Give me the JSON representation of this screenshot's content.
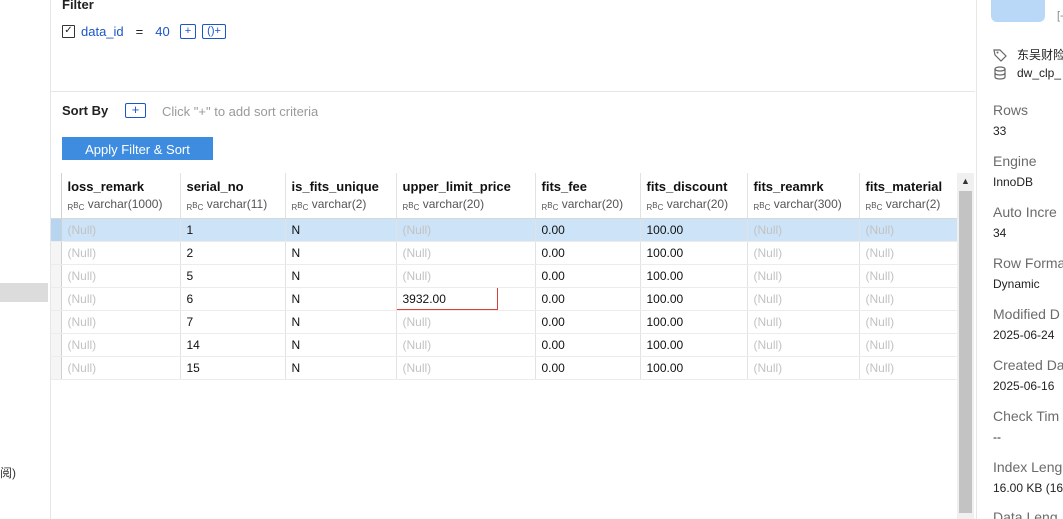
{
  "filter": {
    "title": "Filter",
    "field": "data_id",
    "operator": "=",
    "value": "40",
    "add_btn": "+",
    "group_btn": "()+"
  },
  "sort": {
    "label": "Sort By",
    "add_btn": "+",
    "hint": "Click \"+\" to add sort criteria"
  },
  "apply_button": "Apply Filter & Sort",
  "grid": {
    "columns": [
      {
        "name": "loss_remark",
        "type": "varchar(1000)"
      },
      {
        "name": "serial_no",
        "type": "varchar(11)"
      },
      {
        "name": "is_fits_unique",
        "type": "varchar(2)"
      },
      {
        "name": "upper_limit_price",
        "type": "varchar(20)"
      },
      {
        "name": "fits_fee",
        "type": "varchar(20)"
      },
      {
        "name": "fits_discount",
        "type": "varchar(20)"
      },
      {
        "name": "fits_reamrk",
        "type": "varchar(300)"
      },
      {
        "name": "fits_material",
        "type": "varchar(2)"
      }
    ],
    "rows": [
      [
        "(Null)",
        "1",
        "N",
        "(Null)",
        "0.00",
        "100.00",
        "(Null)",
        "(Null)"
      ],
      [
        "(Null)",
        "2",
        "N",
        "(Null)",
        "0.00",
        "100.00",
        "(Null)",
        "(Null)"
      ],
      [
        "(Null)",
        "5",
        "N",
        "(Null)",
        "0.00",
        "100.00",
        "(Null)",
        "(Null)"
      ],
      [
        "(Null)",
        "6",
        "N",
        "3932.00",
        "0.00",
        "100.00",
        "(Null)",
        "(Null)"
      ],
      [
        "(Null)",
        "7",
        "N",
        "(Null)",
        "0.00",
        "100.00",
        "(Null)",
        "(Null)"
      ],
      [
        "(Null)",
        "14",
        "N",
        "(Null)",
        "0.00",
        "100.00",
        "(Null)",
        "(Null)"
      ],
      [
        "(Null)",
        "15",
        "N",
        "(Null)",
        "0.00",
        "100.00",
        "(Null)",
        "(Null)"
      ]
    ],
    "selected_row": 0,
    "edited_cell": {
      "row": 3,
      "col": 3
    }
  },
  "left_fragment": "阅)",
  "right_panel": {
    "bracket": "[-",
    "database": "东吴财险",
    "table": "dw_clp_",
    "props": [
      {
        "label": "Rows",
        "value": "33"
      },
      {
        "label": "Engine",
        "value": "InnoDB"
      },
      {
        "label": "Auto Incre",
        "value": "34"
      },
      {
        "label": "Row Forma",
        "value": "Dynamic"
      },
      {
        "label": "Modified D",
        "value": "2025-06-24"
      },
      {
        "label": "Created Da",
        "value": "2025-06-16"
      },
      {
        "label": "Check Tim",
        "value": "--"
      },
      {
        "label": "Index Leng",
        "value": "16.00 KB (16"
      },
      {
        "label": "Data Leng",
        "value": ""
      }
    ]
  },
  "colors": {
    "accent": "#3d8ce0",
    "link": "#1a56c8",
    "selected_row": "#cde3f7",
    "edit_border": "#e03a3a"
  }
}
